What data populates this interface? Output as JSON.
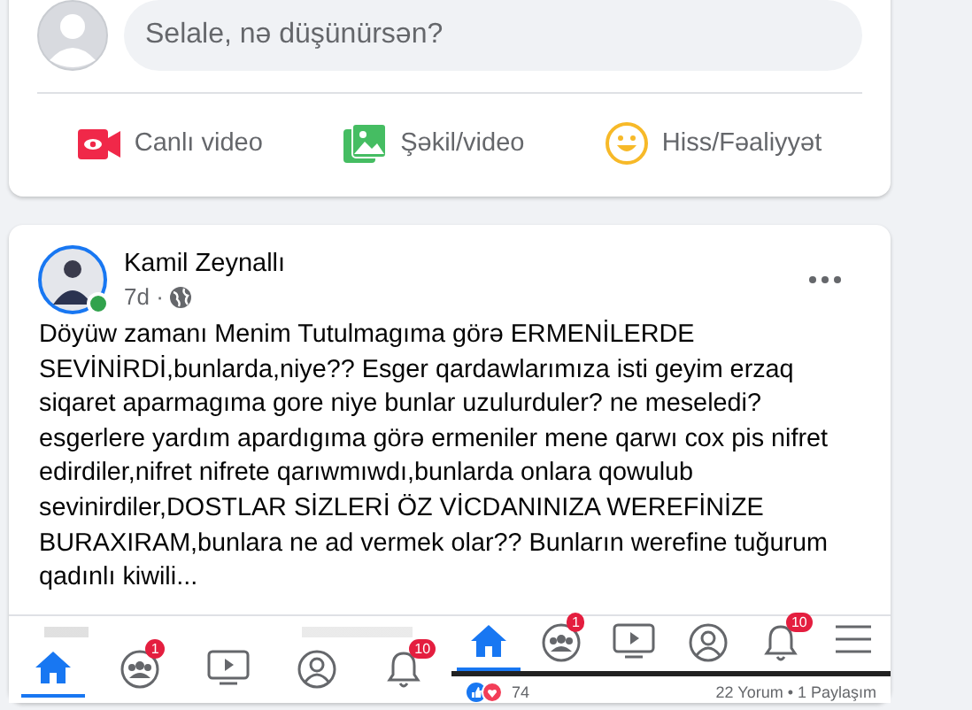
{
  "composer": {
    "placeholder": "Selale, nə düşünürsən?",
    "actions": [
      {
        "kind": "live",
        "label": "Canlı video"
      },
      {
        "kind": "photo",
        "label": "Şəkil/video"
      },
      {
        "kind": "feeling",
        "label": "Hiss/Fəaliyyət"
      }
    ]
  },
  "post": {
    "author": "Kamil Zeynallı",
    "time": "7d ·",
    "online": true,
    "text": "Döyüw zamanı Menim Tutulmagıma görə ERMENİLERDE SEVİNİRDİ,bunlarda,niye?? Esger qardawlarımıza isti geyim erzaq siqaret aparmagıma gore niye bunlar uzulurduler? ne meseledi? esgerlere yardım apardıgıma görə ermeniler mene qarwı cox pis nifret edirdiler,nifret nifrete qarıwmıwdı,bunlarda onlara qowulub sevinirdiler,DOSTLAR SİZLERİ ÖZ VİCDANINIZA WEREFİNİZE BURAXIRAM,bunlara ne ad vermek olar?? Bunların werefine tuğurum qadınlı kiwili...",
    "screenshots": [
      {
        "status_bar": true,
        "tabs": [
          {
            "kind": "home",
            "selected": true
          },
          {
            "kind": "groups",
            "badge": "1",
            "selected": false
          },
          {
            "kind": "video",
            "selected": false
          },
          {
            "kind": "profile",
            "selected": false
          },
          {
            "kind": "bell",
            "badge": "10",
            "selected": false
          }
        ]
      },
      {
        "status_bar": false,
        "tabs": [
          {
            "kind": "home",
            "selected": true
          },
          {
            "kind": "groups",
            "badge": "1",
            "selected": false
          },
          {
            "kind": "video",
            "selected": false
          },
          {
            "kind": "profile",
            "selected": false
          },
          {
            "kind": "bell",
            "badge": "10",
            "selected": false
          },
          {
            "kind": "menu",
            "selected": false
          }
        ],
        "reaction_count": "74",
        "comments_shares": "22 Yorum • 1 Paylaşım"
      }
    ]
  }
}
